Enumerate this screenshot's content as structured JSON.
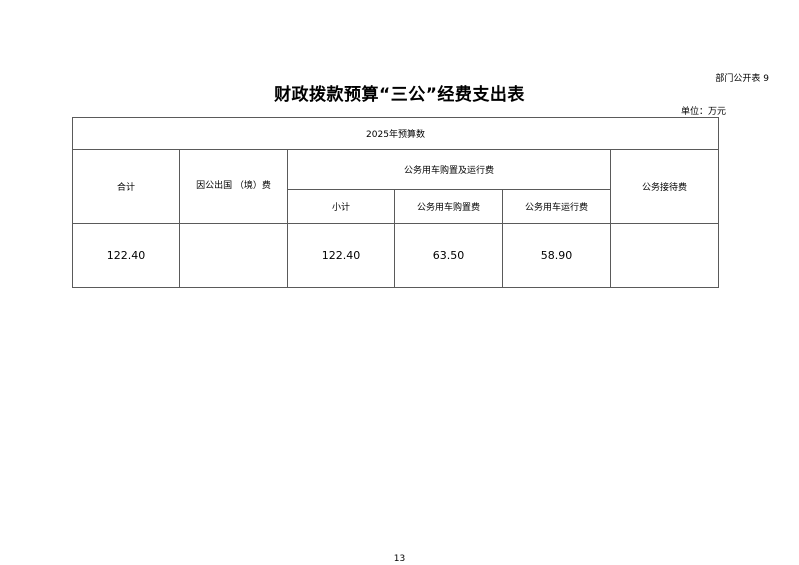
{
  "header": {
    "doc_label": "部门公开表 9",
    "title": "财政拨款预算“三公”经费支出表",
    "unit": "单位：万元"
  },
  "table": {
    "year_header": "2025年预算数",
    "col_total": "合计",
    "col_abroad": "因公出国 （境）费",
    "col_vehicle_group": "公务用车购置及运行费",
    "col_subtotal": "小计",
    "col_vehicle_purchase": "公务用车购置费",
    "col_vehicle_operation": "公务用车运行费",
    "col_reception": "公务接待费",
    "row": {
      "total": "122.40",
      "abroad": "",
      "subtotal": "122.40",
      "vehicle_purchase": "63.50",
      "vehicle_operation": "58.90",
      "reception": ""
    }
  },
  "footer": {
    "page_number": "13"
  }
}
